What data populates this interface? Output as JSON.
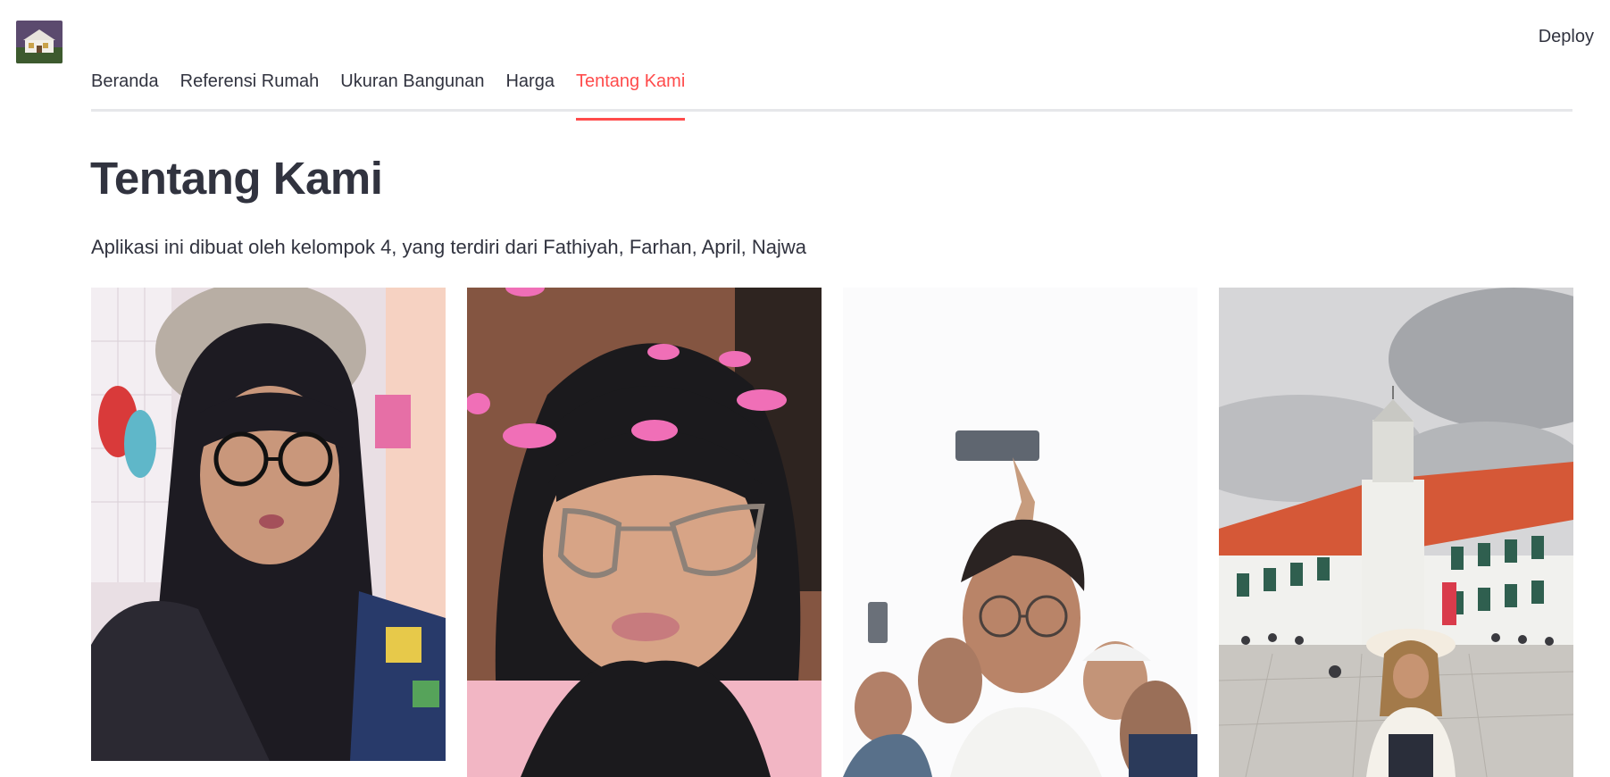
{
  "header": {
    "logo_icon": "house-logo-icon",
    "deploy_label": "Deploy"
  },
  "tabs": [
    {
      "label": "Beranda",
      "active": false
    },
    {
      "label": "Referensi Rumah",
      "active": false
    },
    {
      "label": "Ukuran Bangunan",
      "active": false
    },
    {
      "label": "Harga",
      "active": false
    },
    {
      "label": "Tentang Kami",
      "active": true
    }
  ],
  "main": {
    "title": "Tentang Kami",
    "description": "Aplikasi ini dibuat oleh kelompok 4, yang terdiri dari Fathiyah, Farhan, April, Najwa"
  },
  "colors": {
    "accent": "#ff4b4b",
    "text": "#31333f",
    "divider": "#e6e7ea"
  },
  "photos": [
    {
      "icon": "member-photo-1"
    },
    {
      "icon": "member-photo-2"
    },
    {
      "icon": "member-photo-3"
    },
    {
      "icon": "member-photo-4"
    }
  ]
}
